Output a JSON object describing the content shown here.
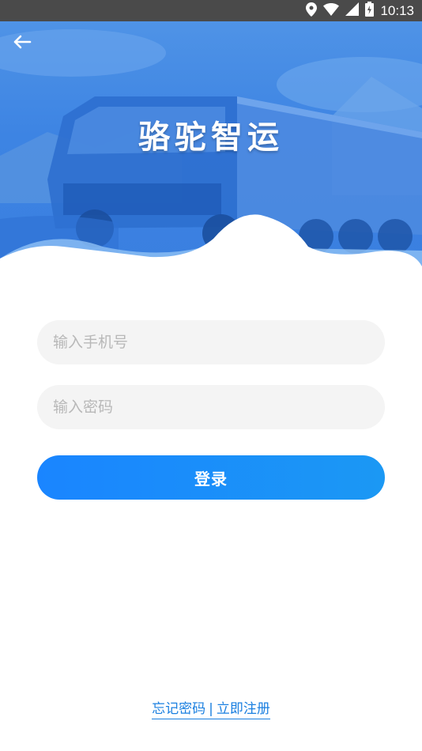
{
  "status_bar": {
    "time": "10:13"
  },
  "header": {
    "title": "骆驼智运"
  },
  "form": {
    "phone_placeholder": "输入手机号",
    "password_placeholder": "输入密码",
    "login_label": "登录"
  },
  "footer": {
    "forgot_password": "忘记密码",
    "separator": "|",
    "register_now": "立即注册"
  },
  "colors": {
    "accent": "#1a85ff",
    "hero_blue": "#3d84e3",
    "field_bg": "#f4f4f4",
    "link": "#1a7fe0"
  },
  "icons": [
    "location-icon",
    "wifi-icon",
    "cell-signal-icon",
    "battery-icon",
    "back-arrow-icon"
  ]
}
